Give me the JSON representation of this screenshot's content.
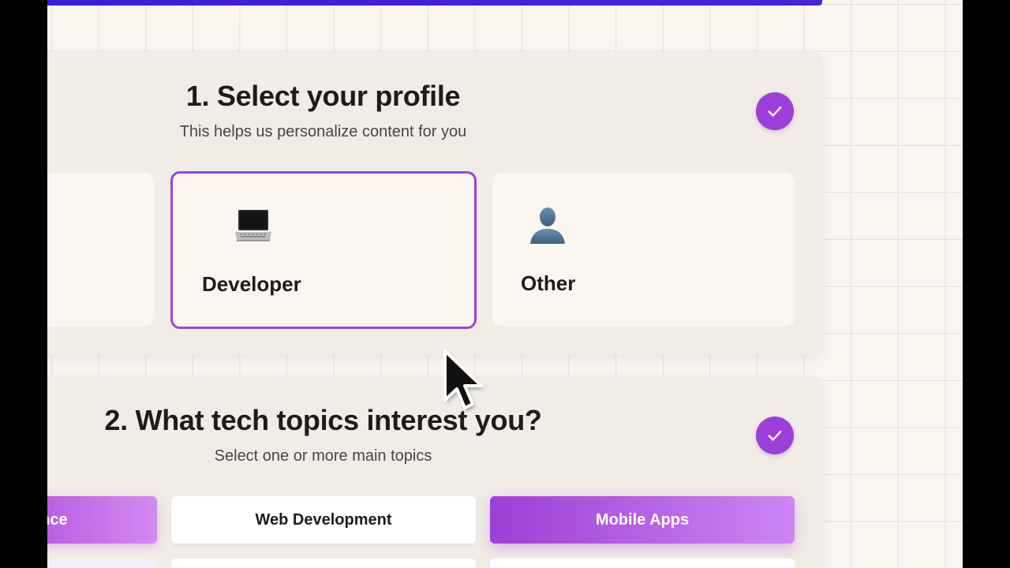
{
  "header": {
    "accent_color": "#3a1fd4"
  },
  "step1": {
    "title": "1. Select your profile",
    "subtitle": "This helps us personalize content for you",
    "completed_icon": "check-icon",
    "profiles": [
      {
        "label": "",
        "icon": "",
        "selected": false
      },
      {
        "label": "Developer",
        "icon": "laptop-icon",
        "selected": true
      },
      {
        "label": "Other",
        "icon": "person-icon",
        "selected": false
      }
    ]
  },
  "step2": {
    "title": "2. What tech topics interest you?",
    "subtitle": "Select one or more main topics",
    "completed_icon": "check-icon",
    "topics": [
      {
        "label": "ence",
        "selected": true
      },
      {
        "label": "Web Development",
        "selected": false
      },
      {
        "label": "Mobile Apps",
        "selected": true
      }
    ]
  },
  "colors": {
    "accent_purple": "#9b3fd8",
    "selected_border": "#9b44d6",
    "card_bg": "#f1ece6",
    "page_bg": "#fcf6f1"
  }
}
